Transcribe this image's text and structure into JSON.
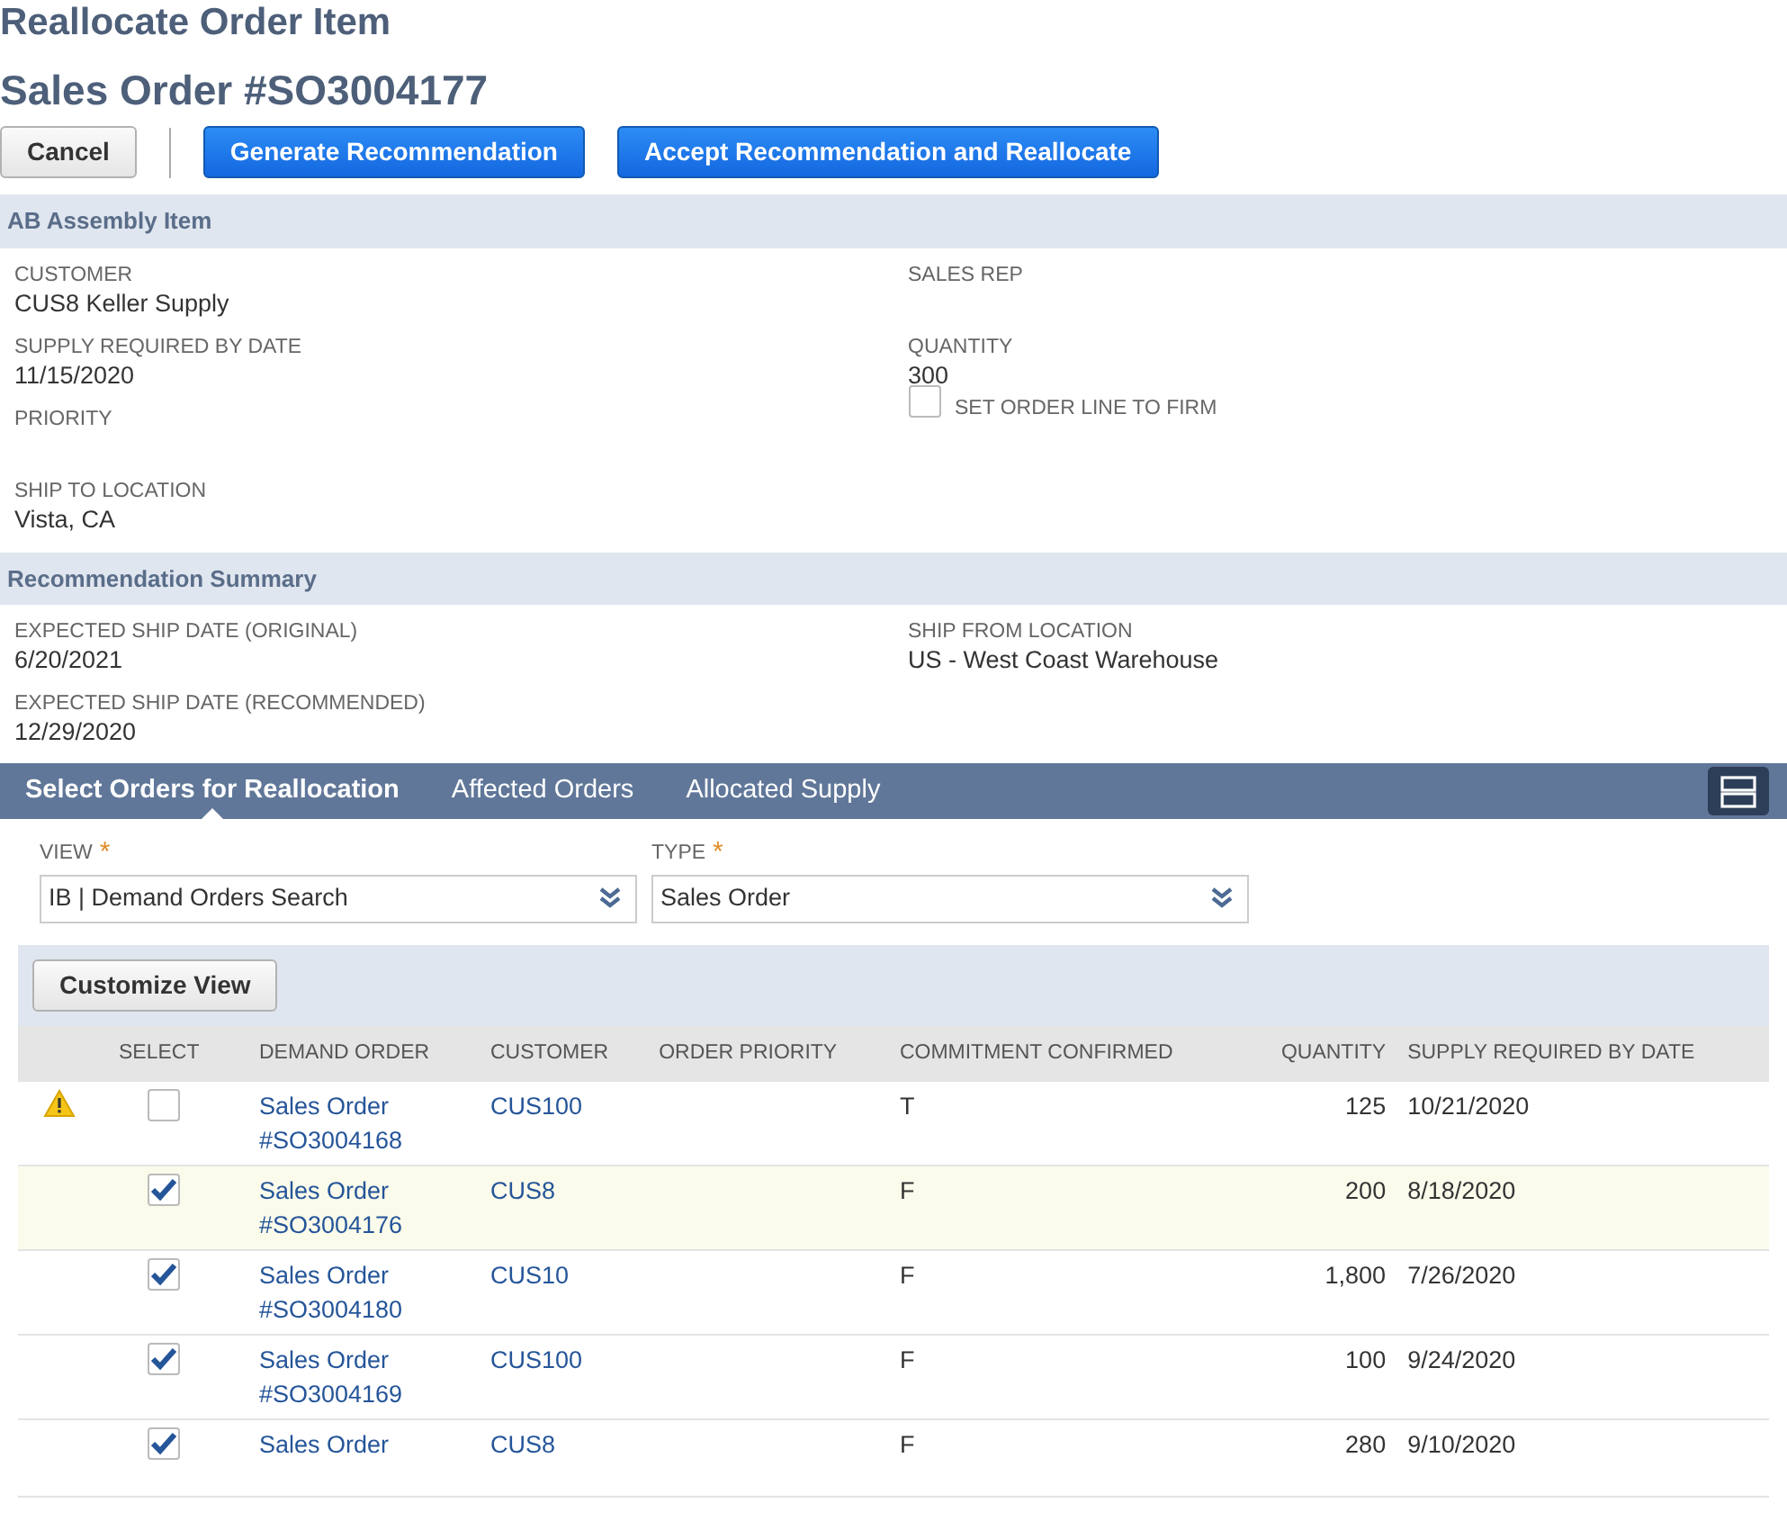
{
  "page": {
    "title": "Reallocate Order Item",
    "subtitle": "Sales Order #SO3004177"
  },
  "buttons": [
    {
      "label": "Cancel",
      "kind": "secondary"
    },
    {
      "label": "Generate Recommendation",
      "kind": "primary"
    },
    {
      "label": "Accept Recommendation and Reallocate",
      "kind": "primary"
    }
  ],
  "item_section": {
    "title": "AB Assembly Item",
    "left_fields": [
      {
        "label": "CUSTOMER",
        "value": "CUS8 Keller Supply"
      },
      {
        "label": "SUPPLY REQUIRED BY DATE",
        "value": "11/15/2020"
      },
      {
        "label": "PRIORITY"
      },
      {
        "label": "SHIP TO LOCATION",
        "value": "Vista, CA"
      }
    ],
    "right_fields": [
      {
        "label": "SALES REP"
      },
      {
        "label": "QUANTITY",
        "value": "300"
      }
    ],
    "firm_checkbox": {
      "label": "SET ORDER LINE TO FIRM",
      "checked": false
    }
  },
  "summary_section": {
    "title": "Recommendation Summary",
    "left_fields": [
      {
        "label": "EXPECTED SHIP DATE (ORIGINAL)",
        "value": "6/20/2021"
      },
      {
        "label": "EXPECTED SHIP DATE (RECOMMENDED)",
        "value": "12/29/2020"
      }
    ],
    "right_fields": [
      {
        "label": "SHIP FROM LOCATION",
        "value": "US - West Coast Warehouse"
      }
    ]
  },
  "tabs": [
    {
      "label": "Select Orders for Reallocation",
      "selected": true
    },
    {
      "label": "Affected Orders",
      "selected": false
    },
    {
      "label": "Allocated Supply",
      "selected": false
    }
  ],
  "filters": [
    {
      "label": "VIEW",
      "required_mark": "*",
      "value": "IB | Demand Orders Search"
    },
    {
      "label": "TYPE",
      "required_mark": "*",
      "value": "Sales Order"
    }
  ],
  "customize_button": "Customize View",
  "table": {
    "columns": [
      "",
      "SELECT",
      "DEMAND ORDER",
      "CUSTOMER",
      "ORDER PRIORITY",
      "COMMITMENT CONFIRMED",
      "QUANTITY",
      "SUPPLY REQUIRED BY DATE"
    ],
    "rows": [
      {
        "warning": true,
        "checked": false,
        "highlighted": false,
        "demand_order": [
          "Sales Order",
          "#SO3004168"
        ],
        "customer": "CUS100",
        "commitment_confirmed": "T",
        "quantity": "125",
        "supply_required_by_date": "10/21/2020"
      },
      {
        "warning": false,
        "checked": true,
        "highlighted": true,
        "demand_order": [
          "Sales Order",
          "#SO3004176"
        ],
        "customer": "CUS8",
        "commitment_confirmed": "F",
        "quantity": "200",
        "supply_required_by_date": "8/18/2020"
      },
      {
        "warning": false,
        "checked": true,
        "highlighted": false,
        "demand_order": [
          "Sales Order",
          "#SO3004180"
        ],
        "customer": "CUS10",
        "commitment_confirmed": "F",
        "quantity": "1,800",
        "supply_required_by_date": "7/26/2020"
      },
      {
        "warning": false,
        "checked": true,
        "highlighted": false,
        "demand_order": [
          "Sales Order",
          "#SO3004169"
        ],
        "customer": "CUS100",
        "commitment_confirmed": "F",
        "quantity": "100",
        "supply_required_by_date": "9/24/2020"
      },
      {
        "warning": false,
        "checked": true,
        "highlighted": false,
        "demand_order": [
          "Sales Order"
        ],
        "customer": "CUS8",
        "commitment_confirmed": "F",
        "quantity": "280",
        "supply_required_by_date": "9/10/2020"
      }
    ]
  }
}
